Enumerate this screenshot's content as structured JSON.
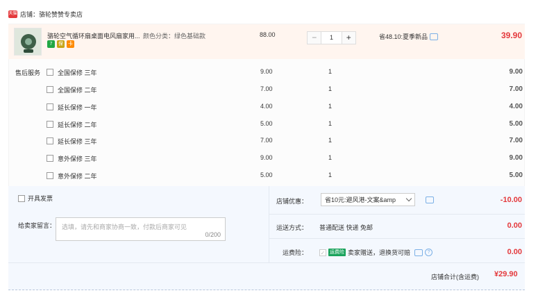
{
  "shop": {
    "badge": "天猫",
    "label": "店铺：骆轮赞赞专卖店"
  },
  "product": {
    "title": "骆轮空气循环扇桌面电风扇家用...",
    "sku": "颜色分类：绿色基础款",
    "badges": [
      "7",
      "保",
      "卡"
    ],
    "unit_price": "88.00",
    "quantity": "1",
    "minus": "−",
    "plus": "+",
    "promo": "省48.10:夏季新品",
    "subtotal": "39.90"
  },
  "services": {
    "label": "售后服务",
    "items": [
      {
        "name": "全国保修 三年",
        "price": "9.00",
        "qty": "1",
        "total": "9.00"
      },
      {
        "name": "全国保修 二年",
        "price": "7.00",
        "qty": "1",
        "total": "7.00"
      },
      {
        "name": "延长保修 一年",
        "price": "4.00",
        "qty": "1",
        "total": "4.00"
      },
      {
        "name": "延长保修 二年",
        "price": "5.00",
        "qty": "1",
        "total": "5.00"
      },
      {
        "name": "延长保修 三年",
        "price": "7.00",
        "qty": "1",
        "total": "7.00"
      },
      {
        "name": "意外保修 三年",
        "price": "9.00",
        "qty": "1",
        "total": "9.00"
      },
      {
        "name": "意外保修 二年",
        "price": "5.00",
        "qty": "1",
        "total": "5.00"
      }
    ]
  },
  "invoice": {
    "label": "开具发票"
  },
  "message": {
    "label": "给卖家留言：",
    "placeholder": "选填，请先和商家协商一致，付款后商家可见",
    "count": "0/200"
  },
  "coupon": {
    "label": "店铺优惠：",
    "selected": "省10元:避风港-文案&amp",
    "value": "-10.00"
  },
  "shipping": {
    "label": "运送方式：",
    "method": "普通配送 快递 免邮",
    "value": "0.00"
  },
  "insurance": {
    "label": "运费险：",
    "tag": "运费险",
    "text": "卖家赠送，退换货可赔",
    "value": "0.00"
  },
  "summary": {
    "label": "店铺合计(含运费)",
    "value": "¥29.90"
  },
  "colors": {
    "accent": "#e4393c",
    "product_bg": "#fff5ef",
    "panel_bg": "#f4f8fe",
    "link": "#7bb0e6"
  }
}
